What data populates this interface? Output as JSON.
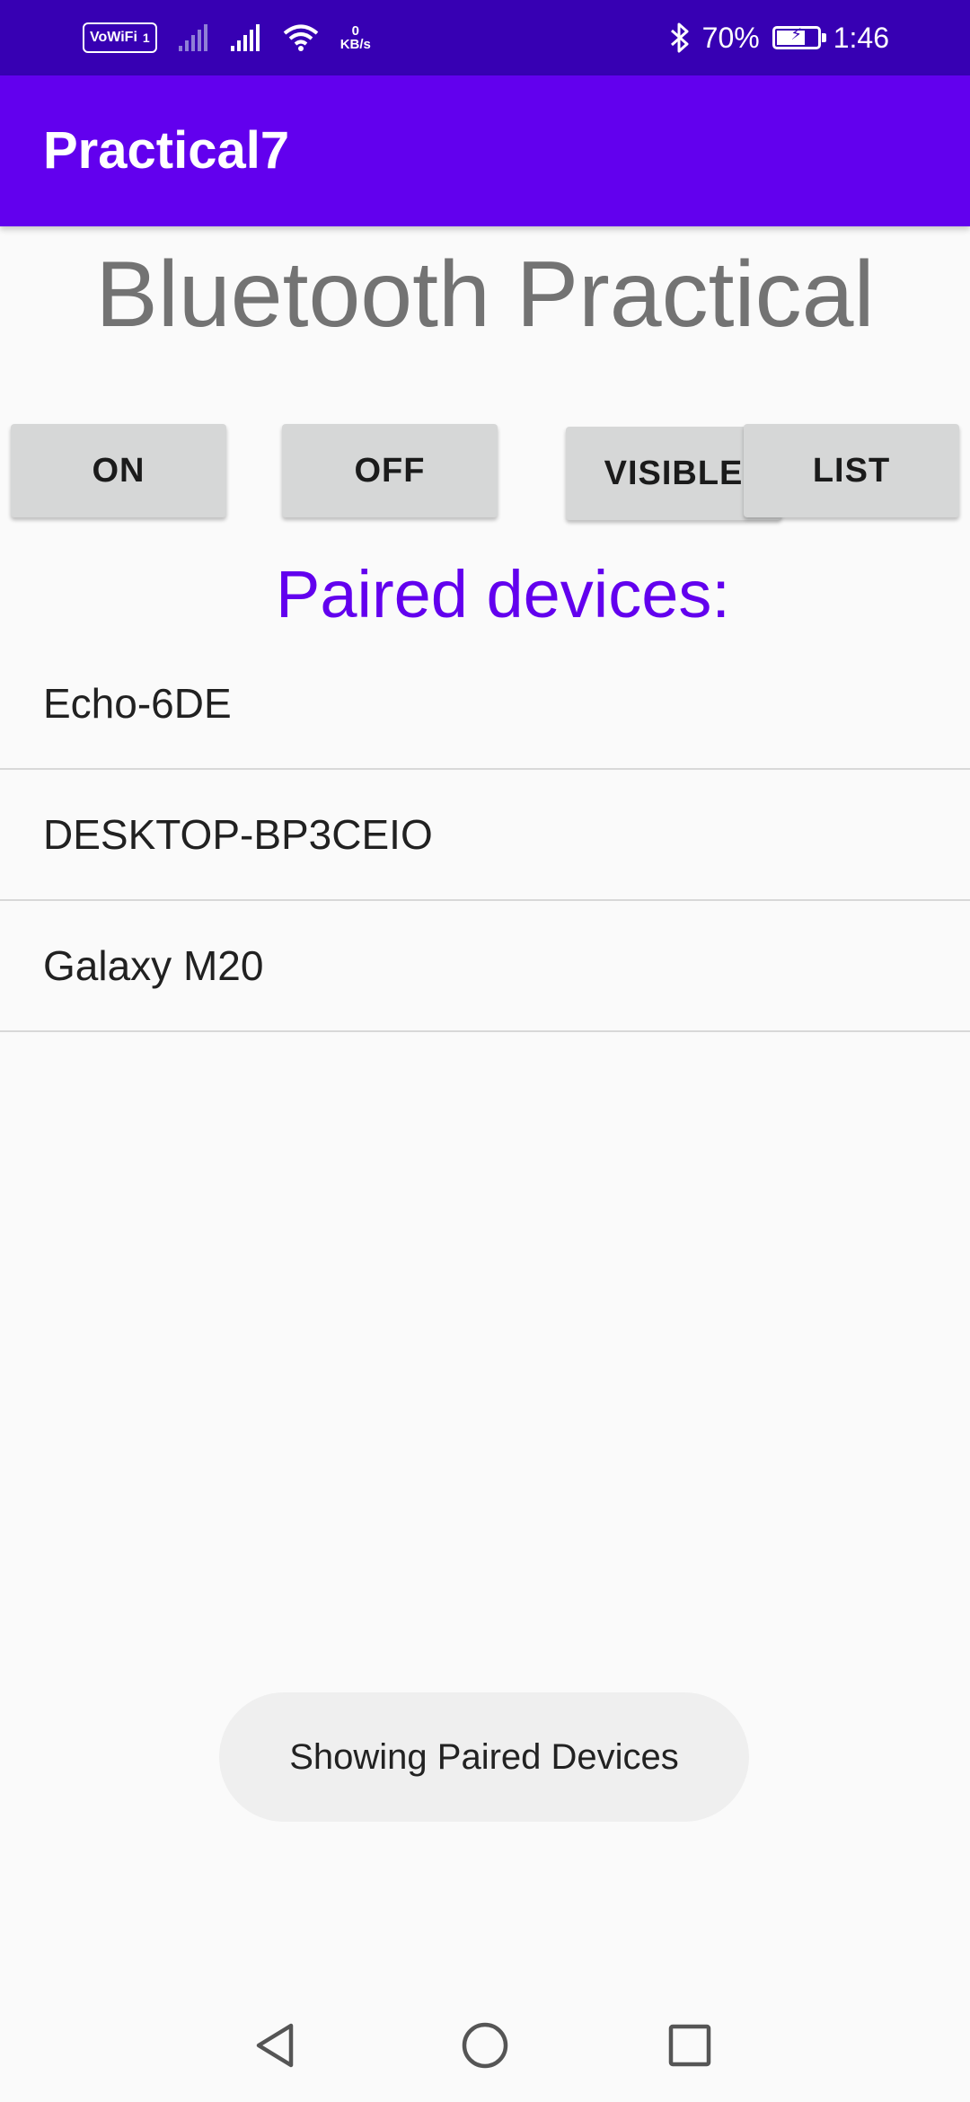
{
  "status_bar": {
    "vowifi_label": "VoWiFi",
    "sim_label": "1",
    "net_speed_value": "0",
    "net_speed_unit": "KB/s",
    "battery_percent": "70%",
    "battery_level": 0.7,
    "time": "1:46",
    "icons": [
      "vowifi-icon",
      "signal-icon",
      "signal-icon",
      "wifi-icon",
      "bluetooth-icon",
      "battery-icon"
    ]
  },
  "app_bar": {
    "title": "Practical7"
  },
  "main": {
    "heading": "Bluetooth Practical",
    "buttons": [
      {
        "label": "ON"
      },
      {
        "label": "OFF"
      },
      {
        "label": "VISIBLE"
      },
      {
        "label": "LIST"
      }
    ],
    "paired_heading": "Paired devices:",
    "devices": [
      {
        "name": "Echo-6DE"
      },
      {
        "name": "DESKTOP-BP3CEIO"
      },
      {
        "name": "Galaxy M20"
      }
    ]
  },
  "toast": {
    "message": "Showing Paired Devices"
  },
  "nav_bar": {
    "icons": [
      "back-icon",
      "home-icon",
      "recents-icon"
    ]
  },
  "colors": {
    "status_bar": "#3700b3",
    "app_bar": "#6200ee",
    "accent": "#6200ee",
    "heading_gray": "#737373",
    "button_bg": "#d6d7d7",
    "background": "#fafafa"
  }
}
